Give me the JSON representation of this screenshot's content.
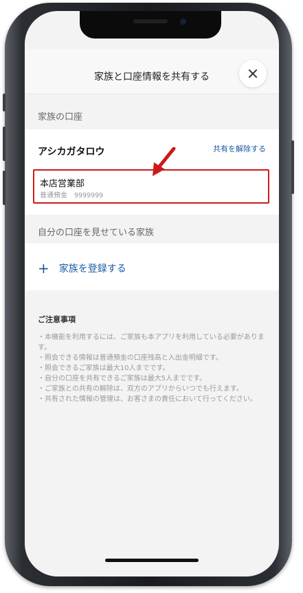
{
  "header": {
    "title": "家族と口座情報を共有する"
  },
  "family_accounts": {
    "section_label": "家族の口座",
    "member_name": "アシカガタロウ",
    "unshare_label": "共有を解除する",
    "branch": "本店営業部",
    "account_type": "普通預金",
    "account_number": "9999999"
  },
  "my_accounts": {
    "section_label": "自分の口座を見せている家族",
    "register_label": "家族を登録する"
  },
  "notice": {
    "title": "ご注意事項",
    "items": [
      "・本機能を利用するには、ご家族も本アプリを利用している必要があります。",
      "・照会できる情報は普通預金の口座残高と入出金明細です。",
      "・照会できるご家族は最大10人までです。",
      "・自分の口座を共有できるご家族は最大5人までです。",
      "・ご家族との共有の解除は、双方のアプリからいつでも行えます。",
      "・共有された情報の管理は、お客さまの責任において行ってください。"
    ]
  },
  "colors": {
    "link": "#1a5aa0",
    "highlight": "#cc1a1a"
  }
}
